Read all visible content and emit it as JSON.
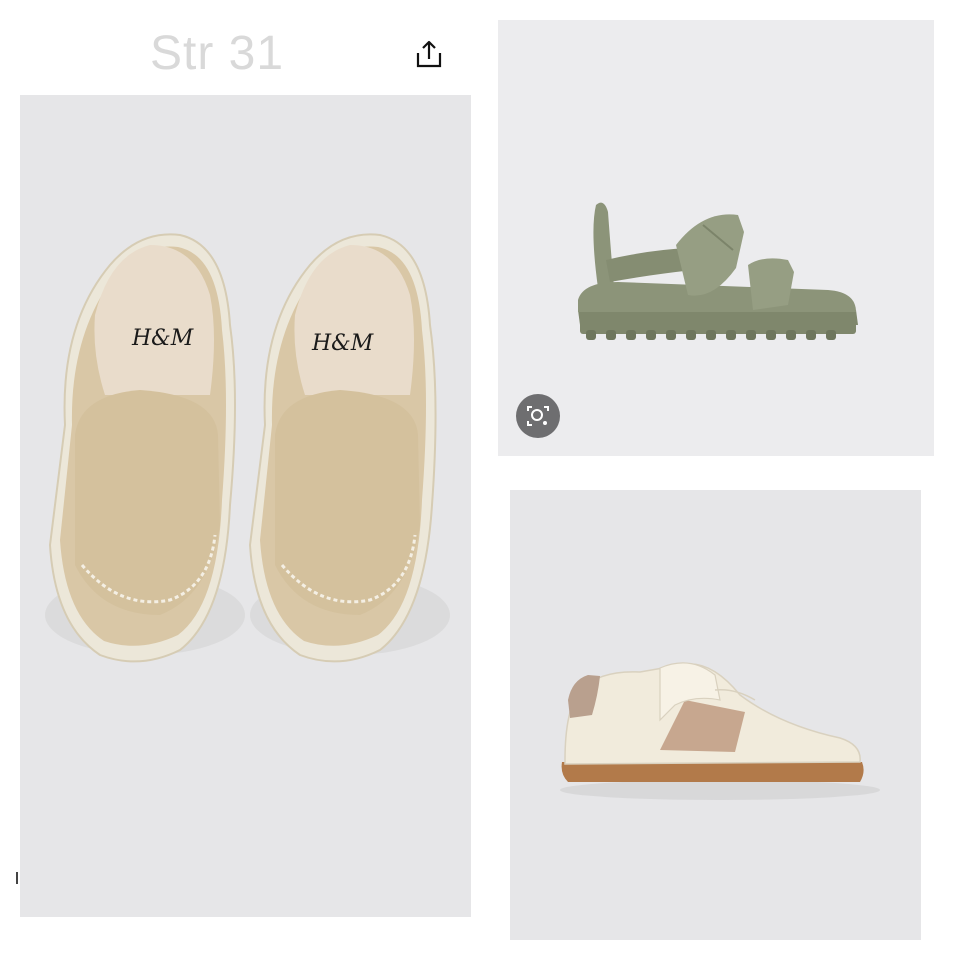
{
  "header": {
    "title": "Str 31",
    "share_icon": "share-icon"
  },
  "products": [
    {
      "name": "loafer",
      "brand_print": "H&M",
      "color": "#dcc9ab"
    },
    {
      "name": "sandal",
      "color": "#8c9479"
    },
    {
      "name": "sneaker",
      "color": "#f1ebdc",
      "accent": "#b9a08e",
      "sole": "#b27a4a"
    }
  ],
  "controls": {
    "lens_icon": "visual-search-icon"
  },
  "colors": {
    "background": "#ffffff",
    "panel": "#e6e6e8",
    "title": "#d9d9d9"
  }
}
